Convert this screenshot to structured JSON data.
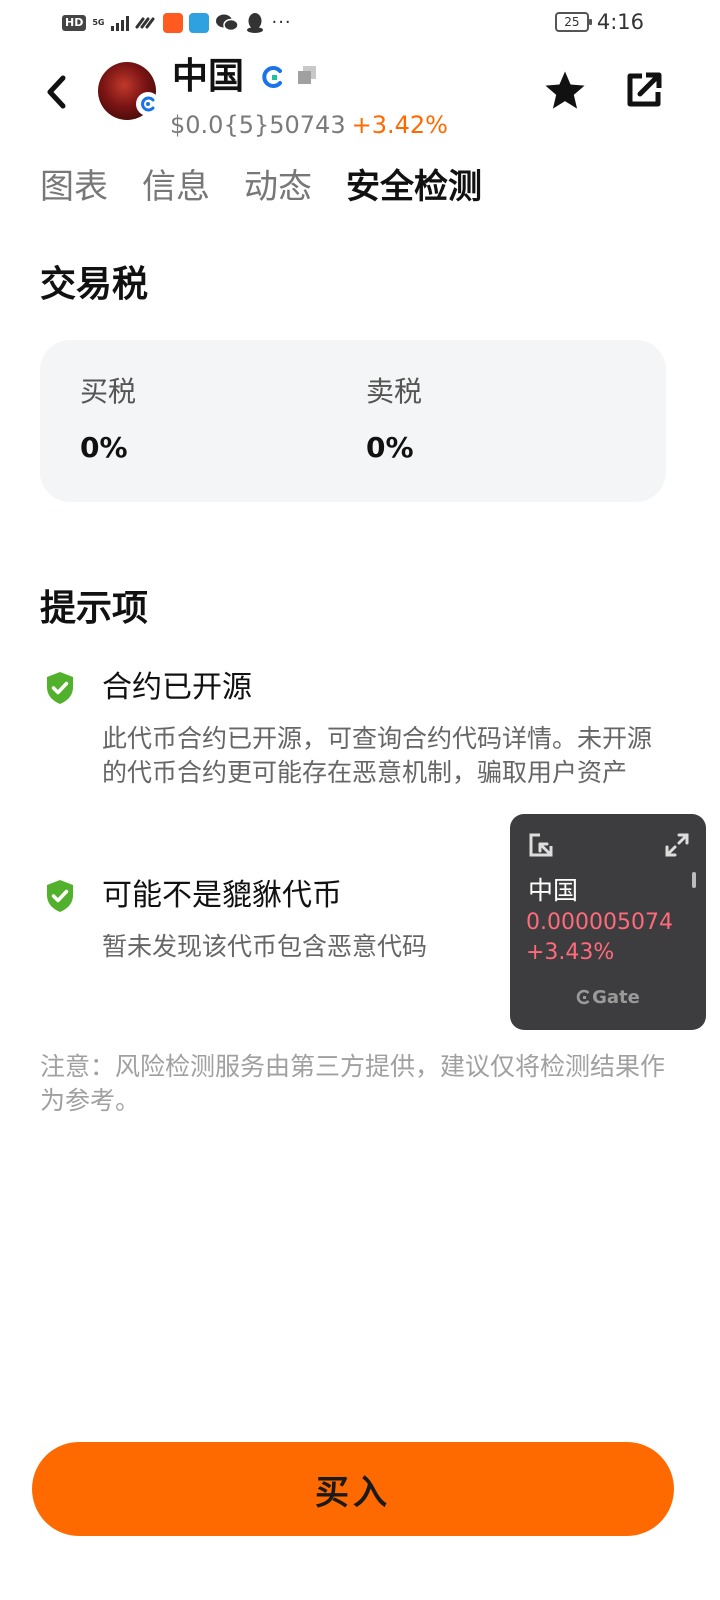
{
  "status_bar": {
    "network_badge": "HD",
    "network_type": "5G",
    "battery": "25",
    "time": "4:16",
    "overflow": "···"
  },
  "header": {
    "token_name": "中国",
    "price": "$0.0{5}50743",
    "change": "+3.42%",
    "change_color": "#ff6a00"
  },
  "tabs": [
    {
      "label": "图表",
      "active": false
    },
    {
      "label": "信息",
      "active": false
    },
    {
      "label": "动态",
      "active": false
    },
    {
      "label": "安全检测",
      "active": true
    }
  ],
  "tax": {
    "title": "交易税",
    "buy_label": "买税",
    "buy_value": "0%",
    "sell_label": "卖税",
    "sell_value": "0%"
  },
  "tips": {
    "title": "提示项",
    "items": [
      {
        "title": "合约已开源",
        "description": "此代币合约已开源，可查询合约代码详情。未开源的代币合约更可能存在恶意机制，骗取用户资产",
        "icon": "shield-check-icon"
      },
      {
        "title": "可能不是貔貅代币",
        "description": "暂未发现该代币包含恶意代码",
        "icon": "shield-check-icon"
      }
    ]
  },
  "note": "注意：风险检测服务由第三方提供，建议仅将检测结果作为参考。",
  "widget": {
    "name": "中国",
    "price": "0.000005074",
    "change": "+3.43%",
    "brand": "Gate"
  },
  "buy_button": "买入",
  "colors": {
    "accent": "#ff6a00",
    "shield": "#52b12c",
    "widget_bg": "#3d3d3f",
    "widget_red": "#ff6b7a"
  }
}
